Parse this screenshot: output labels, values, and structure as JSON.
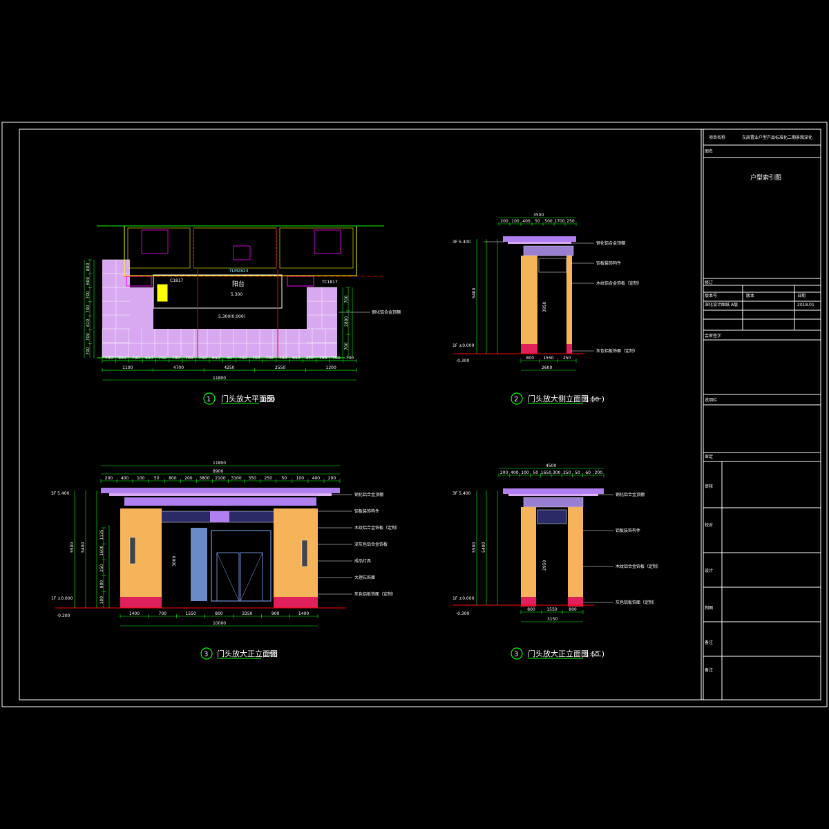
{
  "title_block": {
    "project_label": "项目名称",
    "project_name": "东辰置业户型产品标准化二期景观深化",
    "drawing_label": "图名",
    "drawing_name": "户型索引图",
    "revision_label": "修订",
    "rev_headers": [
      "版本号",
      "版本",
      "日期"
    ],
    "rev_row": [
      "深化设计图纸 A版",
      "",
      "2018.01"
    ],
    "approval_label": "会审签字",
    "notes_label": "说明栏",
    "signoffs": [
      "审定",
      "审核",
      "校对",
      "设计",
      "制图",
      "备注"
    ]
  },
  "views": {
    "v1": {
      "number": "1",
      "title": "门头放大平面图",
      "scale": "1:50"
    },
    "v2": {
      "number": "2",
      "title": "门头放大侧立面图 (一)",
      "scale": "1:50"
    },
    "v3": {
      "number": "3",
      "title": "门头放大正立面图",
      "scale": "1:50"
    },
    "v4": {
      "number": "3",
      "title": "门头放大正立面图 (二)",
      "scale": "1:50"
    }
  },
  "plan": {
    "label_balcony": "阳台",
    "label_door": "TLM2823",
    "label_c1": "C1817",
    "label_c2": "TC1817",
    "elev1": "5.300",
    "elev2": "5.300(0.000)",
    "note1": "钢化铝合金顶棚",
    "top_dims": [
      "700",
      "450",
      "700",
      "650",
      "700",
      "700",
      "700",
      "700",
      "650",
      "50",
      "700",
      "700",
      "700",
      "700",
      "650",
      "450",
      "700",
      "700",
      "700"
    ],
    "mid_dims": [
      "1100",
      "4700",
      "4250",
      "2550",
      "1200"
    ],
    "total": "11800",
    "left_dims": [
      "800",
      "600",
      "700",
      "700",
      "410",
      "700",
      "700"
    ],
    "right_dims": [
      "700",
      "2800",
      "700"
    ]
  },
  "side1": {
    "top_dims": [
      "200",
      "100",
      "400",
      "50",
      "500",
      "1700",
      "250"
    ],
    "top_total": "3500",
    "level_top": "3F 5.400",
    "level_0": "1F ±0.000",
    "level_neg": "-0.300",
    "height": "5400",
    "inner_h": "3950",
    "bottom_dims": [
      "800",
      "1550",
      "250"
    ],
    "bottom_total": "2600",
    "notes": [
      "钢化铝合金顶棚",
      "铝板装饰构件",
      "木纹铝合金饰板（定制）",
      "灰色铝板饰面（定制）"
    ]
  },
  "front": {
    "top_total": "11800",
    "top_dims": [
      "200",
      "400",
      "100",
      "50",
      "800",
      "200",
      "3800",
      "2100",
      "3100",
      "350",
      "250",
      "50",
      "100",
      "400",
      "200"
    ],
    "mid_total": "8900",
    "level_top": "3F 5.400",
    "level_0": "1F ±0.000",
    "level_neg": "-0.300",
    "height": "5400",
    "outer_h": "5500",
    "door_h": "3000",
    "left_dims": [
      "1135",
      "1600",
      "250",
      "800",
      "100"
    ],
    "bottom_dims": [
      "1400",
      "700",
      "1550",
      "800",
      "3350",
      "900",
      "1400"
    ],
    "bottom_total": "10000",
    "notes": [
      "钢化铝合金顶棚",
      "铝板装饰构件",
      "木纹铝合金饰板（定制）",
      "深灰色铝合金饰板",
      "成品灯具",
      "大理石饰面",
      "灰色铝板饰面（定制）"
    ]
  },
  "side2": {
    "top_dims": [
      "200",
      "400",
      "100",
      "50",
      "1650",
      "300",
      "250",
      "50",
      "60",
      "200"
    ],
    "top_total": "4500",
    "level_top": "3F 5.400",
    "level_0": "1F ±0.000",
    "level_neg": "-0.300",
    "height": "5400",
    "outer_h": "5500",
    "inner_h": "2950",
    "bottom_dims": [
      "800",
      "1550",
      "800"
    ],
    "bottom_total": "3150",
    "notes": [
      "钢化铝合金顶棚",
      "铝板装饰构件",
      "木纹铝合金饰板（定制）",
      "灰色铝板饰面（定制）"
    ]
  },
  "colors": {
    "bg": "#000000",
    "frame": "#ffffff",
    "dim": "#00ff00",
    "red": "#ff0000",
    "paving": "#d8a8f0",
    "wall_orange": "#f5b45a",
    "canopy": "#b07ff0",
    "magenta": "#ff00ff",
    "base_red": "#e0205a",
    "glass_blue": "#6a8ac8"
  }
}
